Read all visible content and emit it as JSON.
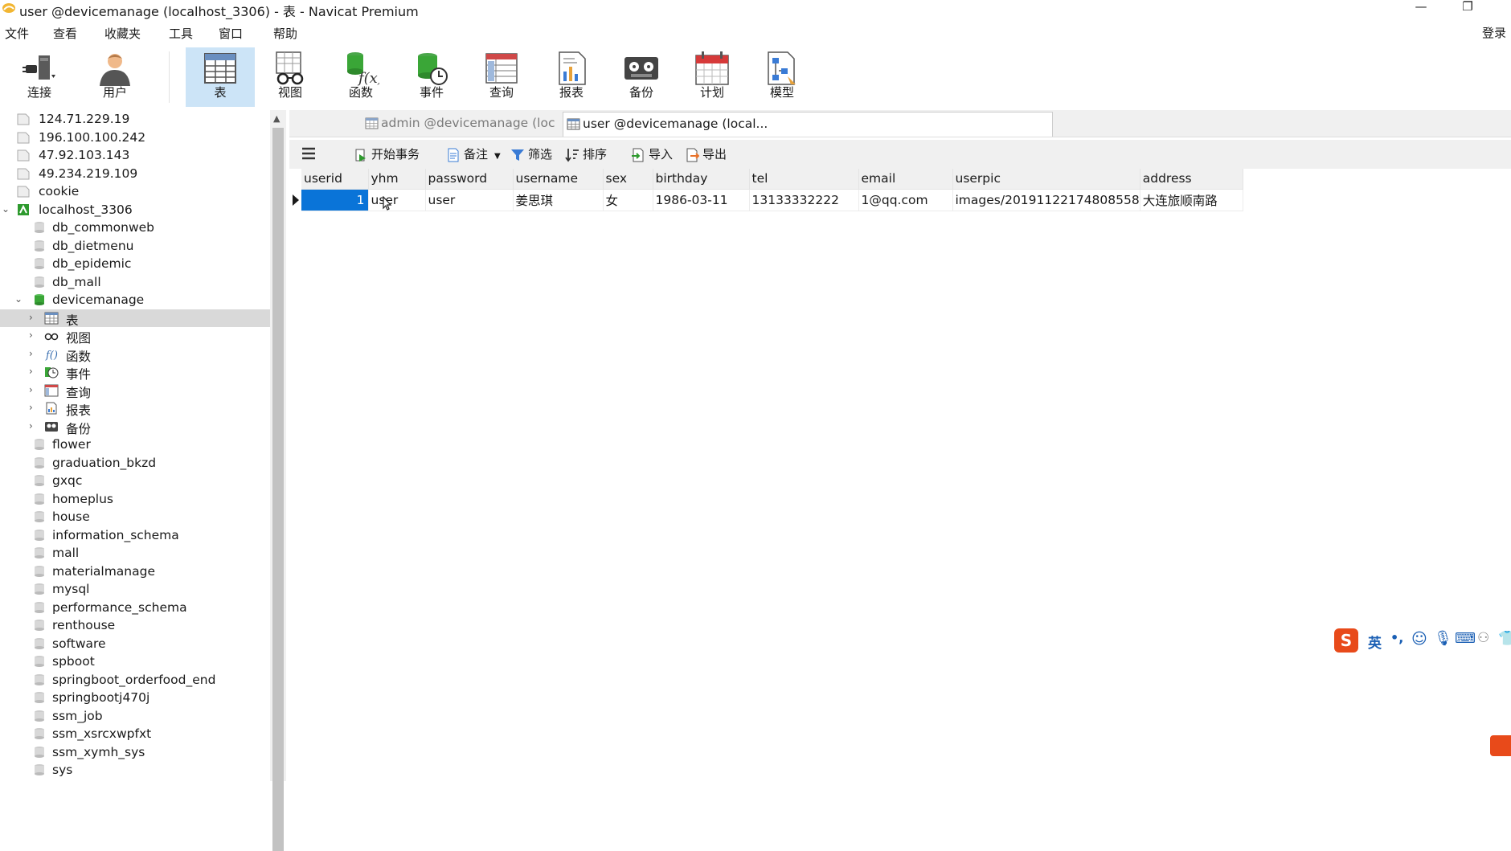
{
  "window": {
    "title": "user @devicemanage (localhost_3306) - 表 - Navicat Premium",
    "minimize": "—",
    "restore": "❐"
  },
  "menu": {
    "items": [
      "文件",
      "查看",
      "收藏夹",
      "工具",
      "窗口",
      "帮助"
    ],
    "login": "登录"
  },
  "toolbar": {
    "buttons": [
      {
        "label": "连接",
        "icon": "plug-icon"
      },
      {
        "label": "用户",
        "icon": "user-icon"
      },
      {
        "label": "表",
        "icon": "table-icon"
      },
      {
        "label": "视图",
        "icon": "view-glasses-icon"
      },
      {
        "label": "函数",
        "icon": "function-icon"
      },
      {
        "label": "事件",
        "icon": "event-clock-icon"
      },
      {
        "label": "查询",
        "icon": "query-icon"
      },
      {
        "label": "报表",
        "icon": "report-icon"
      },
      {
        "label": "备份",
        "icon": "backup-icon"
      },
      {
        "label": "计划",
        "icon": "calendar-icon"
      },
      {
        "label": "模型",
        "icon": "model-icon"
      }
    ],
    "active": "表"
  },
  "sidebar": {
    "connections_top": [
      "124.71.229.19",
      "196.100.100.242",
      "47.92.103.143",
      "49.234.219.109",
      "cookie",
      "localhost_3306"
    ],
    "databases_before": [
      "db_commonweb",
      "db_dietmenu",
      "db_epidemic",
      "db_mall",
      "devicemanage"
    ],
    "children": [
      "表",
      "视图",
      "函数",
      "事件",
      "查询",
      "报表",
      "备份"
    ],
    "databases_after": [
      "flower",
      "graduation_bkzd",
      "gxqc",
      "homeplus",
      "house",
      "information_schema",
      "mall",
      "materialmanage",
      "mysql",
      "performance_schema",
      "renthouse",
      "software",
      "spboot",
      "springboot_orderfood_end",
      "springbootj470j",
      "ssm_job",
      "ssm_xsrcxwpfxt",
      "ssm_xymh_sys",
      "sys"
    ]
  },
  "tabs": [
    {
      "label": "admin @devicemanage (loc...",
      "active": false
    },
    {
      "label": "user @devicemanage (local...",
      "active": true
    }
  ],
  "subtoolbar": {
    "menu_icon": "hamburger-icon",
    "begin_transaction": "开始事务",
    "memo": "备注",
    "filter": "筛选",
    "sort": "排序",
    "import": "导入",
    "export": "导出"
  },
  "table": {
    "columns": [
      "userid",
      "yhm",
      "password",
      "username",
      "sex",
      "birthday",
      "tel",
      "email",
      "userpic",
      "address"
    ],
    "rows": [
      [
        "1",
        "user",
        "user",
        "姜思琪",
        "女",
        "1986-03-11",
        "13133332222",
        "1@qq.com",
        "images/20191122174808558",
        "大连旅顺南路"
      ]
    ]
  },
  "ime": {
    "mode": "英",
    "punct": "•,"
  },
  "colors": {
    "active_tool_bg": "#cce4f7",
    "selected_cell": "#0a74d8",
    "db_green": "#3aa637",
    "sogou_orange": "#e84a1a"
  }
}
